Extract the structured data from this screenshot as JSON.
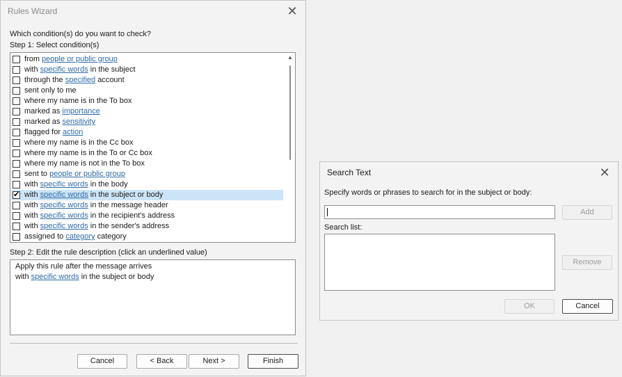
{
  "rules_wizard": {
    "title": "Rules Wizard",
    "question": "Which condition(s) do you want to check?",
    "step1": "Step 1: Select condition(s)",
    "conditions": [
      {
        "pre": "from ",
        "link": "people or public group",
        "post": "",
        "checked": false
      },
      {
        "pre": "with ",
        "link": "specific words",
        "post": " in the subject",
        "checked": false
      },
      {
        "pre": "through the ",
        "link": "specified",
        "post": " account",
        "checked": false
      },
      {
        "pre": "sent only to me",
        "link": "",
        "post": "",
        "checked": false
      },
      {
        "pre": "where my name is in the To box",
        "link": "",
        "post": "",
        "checked": false
      },
      {
        "pre": "marked as ",
        "link": "importance",
        "post": "",
        "checked": false
      },
      {
        "pre": "marked as ",
        "link": "sensitivity",
        "post": "",
        "checked": false
      },
      {
        "pre": "flagged for ",
        "link": "action",
        "post": "",
        "checked": false
      },
      {
        "pre": "where my name is in the Cc box",
        "link": "",
        "post": "",
        "checked": false
      },
      {
        "pre": "where my name is in the To or Cc box",
        "link": "",
        "post": "",
        "checked": false
      },
      {
        "pre": "where my name is not in the To box",
        "link": "",
        "post": "",
        "checked": false
      },
      {
        "pre": "sent to ",
        "link": "people or public group",
        "post": "",
        "checked": false
      },
      {
        "pre": "with ",
        "link": "specific words",
        "post": " in the body",
        "checked": false
      },
      {
        "pre": "with ",
        "link": "specific words",
        "post": " in the subject or body",
        "checked": true,
        "selected": true
      },
      {
        "pre": "with ",
        "link": "specific words",
        "post": " in the message header",
        "checked": false
      },
      {
        "pre": "with ",
        "link": "specific words",
        "post": " in the recipient's address",
        "checked": false
      },
      {
        "pre": "with ",
        "link": "specific words",
        "post": " in the sender's address",
        "checked": false
      },
      {
        "pre": "assigned to ",
        "link": "category",
        "post": " category",
        "checked": false
      }
    ],
    "step2": "Step 2: Edit the rule description (click an underlined value)",
    "description": {
      "line1": "Apply this rule after the message arrives",
      "line2_pre": "with ",
      "line2_link": "specific words",
      "line2_post": " in the subject or body"
    },
    "buttons": {
      "cancel": "Cancel",
      "back": "< Back",
      "next": "Next >",
      "finish": "Finish"
    }
  },
  "search_text": {
    "title": "Search Text",
    "prompt": "Specify words or phrases to search for in the subject or body:",
    "input_value": "",
    "list_label": "Search list:",
    "buttons": {
      "add": "Add",
      "remove": "Remove",
      "ok": "OK",
      "cancel": "Cancel"
    }
  },
  "icons": {
    "close": "close-icon",
    "check": "checkmark-icon",
    "scroll_up": "scroll-up-arrow-icon"
  }
}
